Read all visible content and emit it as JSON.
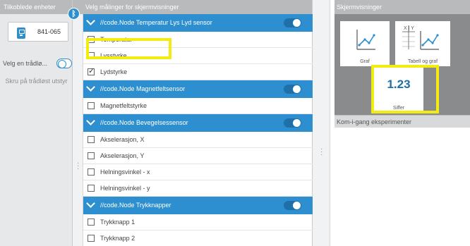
{
  "left_panel": {
    "header": "Tilkoblede enheter",
    "device_id": "841-065",
    "wireless_label": "Velg en trådlø...",
    "hint": "Skru på trådløst utstyr"
  },
  "middle_panel": {
    "header": "Velg målinger for skjermvisninger",
    "sensors": [
      {
        "title": "//code.Node Temperatur Lys Lyd sensor",
        "enabled": true,
        "rows": [
          {
            "label": "Temperatur",
            "checked": false
          },
          {
            "label": "Lysstyrke",
            "checked": false
          },
          {
            "label": "Lydstyrke",
            "checked": true
          }
        ]
      },
      {
        "title": "//code.Node Magnetfeltsensor",
        "enabled": true,
        "rows": [
          {
            "label": "Magnetfeltstyrke",
            "checked": false
          }
        ]
      },
      {
        "title": "//code.Node Bevegelsessensor",
        "enabled": true,
        "rows": [
          {
            "label": "Akselerasjon, X",
            "checked": false
          },
          {
            "label": "Akselerasjon, Y",
            "checked": false
          },
          {
            "label": "Helningsvinkel - x",
            "checked": false
          },
          {
            "label": "Helningsvinkel - y",
            "checked": false
          }
        ]
      },
      {
        "title": "//code.Node Trykknapper",
        "enabled": true,
        "rows": [
          {
            "label": "Trykknapp 1",
            "checked": false
          },
          {
            "label": "Trykknapp 2",
            "checked": false
          }
        ]
      }
    ]
  },
  "right_panel": {
    "header": "Skjermvisninger",
    "views": [
      {
        "label": "Graf",
        "icon": "graph-icon"
      },
      {
        "label": "Tabell og graf",
        "icon": "table-graph-icon",
        "table_header": "X | Y"
      },
      {
        "label": "Siffer",
        "icon": "digits-icon",
        "value": "1.23"
      }
    ],
    "kom_header": "Kom-i-gang eksperimenter"
  },
  "colors": {
    "accent": "#2d8fd0",
    "highlight": "#f3ec11",
    "header_bg": "#b8babc"
  }
}
